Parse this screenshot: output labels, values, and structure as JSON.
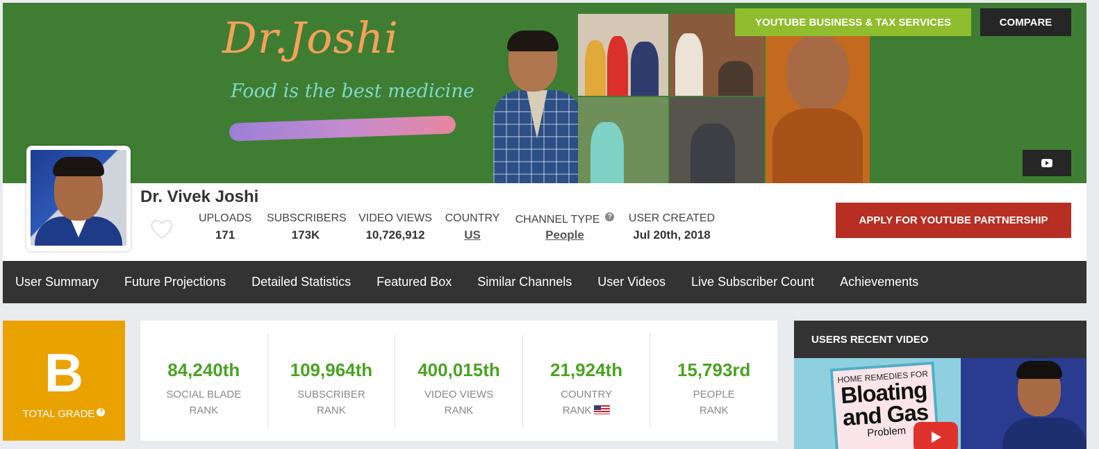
{
  "banner": {
    "title": "Dr.Joshi",
    "tagline": "Food is the best medicine"
  },
  "header_buttons": {
    "business_tax": "YOUTUBE BUSINESS & TAX SERVICES",
    "compare": "COMPARE",
    "partnership": "APPLY FOR YOUTUBE PARTNERSHIP"
  },
  "channel": {
    "name": "Dr. Vivek Joshi",
    "stats": {
      "uploads_label": "UPLOADS",
      "uploads": "171",
      "subscribers_label": "SUBSCRIBERS",
      "subscribers": "173K",
      "views_label": "VIDEO VIEWS",
      "views": "10,726,912",
      "country_label": "COUNTRY",
      "country": "US",
      "type_label": "CHANNEL TYPE",
      "type": "People",
      "created_label": "USER CREATED",
      "created": "Jul 20th, 2018"
    }
  },
  "nav": {
    "items": [
      {
        "label": "User Summary"
      },
      {
        "label": "Future Projections"
      },
      {
        "label": "Detailed Statistics"
      },
      {
        "label": "Featured Box"
      },
      {
        "label": "Similar Channels"
      },
      {
        "label": "User Videos"
      },
      {
        "label": "Live Subscriber Count"
      },
      {
        "label": "Achievements"
      }
    ]
  },
  "grade": {
    "letter": "B",
    "label": "TOTAL GRADE",
    "color": "#eaa200"
  },
  "ranks": [
    {
      "value": "84,240th",
      "line1": "SOCIAL BLADE",
      "line2": "RANK"
    },
    {
      "value": "109,964th",
      "line1": "SUBSCRIBER",
      "line2": "RANK"
    },
    {
      "value": "400,015th",
      "line1": "VIDEO VIEWS",
      "line2": "RANK"
    },
    {
      "value": "21,924th",
      "line1": "COUNTRY",
      "line2": "RANK"
    },
    {
      "value": "15,793rd",
      "line1": "PEOPLE",
      "line2": "RANK"
    }
  ],
  "recent_video": {
    "header": "USERS RECENT VIDEO",
    "thumb_small": "HOME REMEDIES FOR",
    "thumb_big1": "Bloating",
    "thumb_big2": "and Gas",
    "thumb_problem": "Problem"
  },
  "colors": {
    "banner_green": "#3f7d33",
    "rank_green": "#4aa321",
    "partner_red": "#b72f23",
    "services_green": "#8fbd2e",
    "nav_dark": "#333333"
  },
  "icons": [
    "heart-icon",
    "help-icon",
    "youtube-icon",
    "us-flag-icon",
    "play-icon"
  ]
}
